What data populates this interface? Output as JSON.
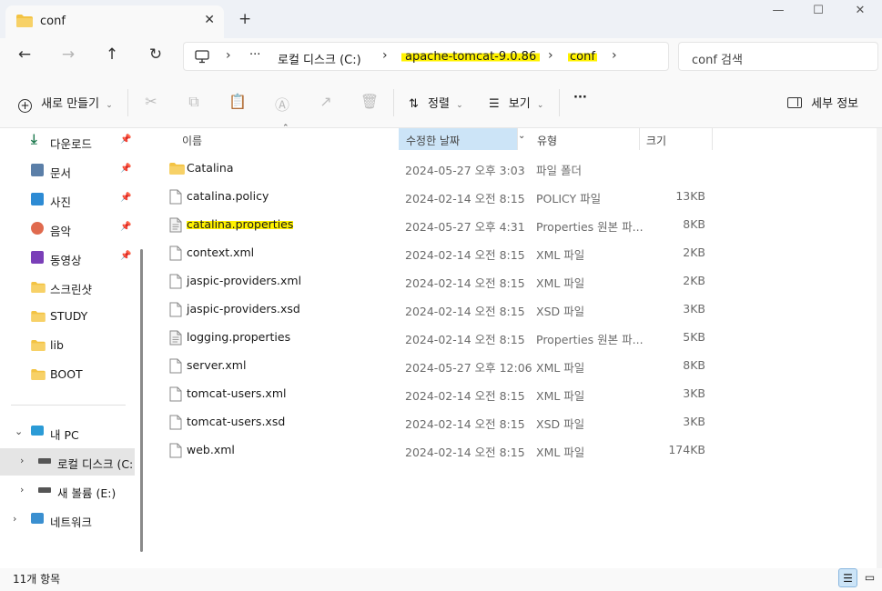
{
  "tab": {
    "title": "conf",
    "close": "✕",
    "new": "+"
  },
  "window": {
    "minimize": "—",
    "maximize": "☐",
    "close": "✕"
  },
  "nav": {
    "back": "←",
    "forward": "→",
    "up": "↑",
    "refresh": "↻"
  },
  "address": {
    "ellipsis": "···",
    "crumbs": [
      "로컬 디스크 (C:)",
      "apache-tomcat-9.0.86",
      "conf"
    ],
    "separator": "›"
  },
  "search": {
    "placeholder": "conf 검색"
  },
  "toolbar": {
    "new_label": "새로 만들기",
    "sort_label": "정렬",
    "view_label": "보기",
    "more_label": "···",
    "details_label": "세부 정보"
  },
  "sidebar": {
    "quick": [
      {
        "label": "다운로드",
        "icon": "download-icon",
        "pinned": true
      },
      {
        "label": "문서",
        "icon": "document-icon",
        "pinned": true
      },
      {
        "label": "사진",
        "icon": "picture-icon",
        "pinned": true
      },
      {
        "label": "음악",
        "icon": "music-icon",
        "pinned": true
      },
      {
        "label": "동영상",
        "icon": "video-icon",
        "pinned": true
      },
      {
        "label": "스크린샷",
        "icon": "folder-icon",
        "pinned": false
      },
      {
        "label": "STUDY",
        "icon": "folder-icon",
        "pinned": false
      },
      {
        "label": "lib",
        "icon": "folder-icon",
        "pinned": false
      },
      {
        "label": "BOOT",
        "icon": "folder-icon",
        "pinned": false
      }
    ],
    "tree": [
      {
        "label": "내 PC",
        "icon": "pc-icon"
      },
      {
        "label": "로컬 디스크 (C:",
        "icon": "drive-icon"
      },
      {
        "label": "새 볼륨 (E:)",
        "icon": "drive-icon"
      },
      {
        "label": "네트워크",
        "icon": "network-icon"
      }
    ]
  },
  "columns": {
    "name": "이름",
    "date": "수정한 날짜",
    "type": "유형",
    "size": "크기"
  },
  "files": [
    {
      "name": "Catalina",
      "date": "2024-05-27 오후 3:03",
      "type": "파일 폴더",
      "size": "",
      "kind": "folder"
    },
    {
      "name": "catalina.policy",
      "date": "2024-02-14 오전 8:15",
      "type": "POLICY 파일",
      "size": "13KB",
      "kind": "file"
    },
    {
      "name": "catalina.properties",
      "date": "2024-05-27 오후 4:31",
      "type": "Properties 원본 파...",
      "size": "8KB",
      "kind": "props",
      "highlight": true
    },
    {
      "name": "context.xml",
      "date": "2024-02-14 오전 8:15",
      "type": "XML 파일",
      "size": "2KB",
      "kind": "file"
    },
    {
      "name": "jaspic-providers.xml",
      "date": "2024-02-14 오전 8:15",
      "type": "XML 파일",
      "size": "2KB",
      "kind": "file"
    },
    {
      "name": "jaspic-providers.xsd",
      "date": "2024-02-14 오전 8:15",
      "type": "XSD 파일",
      "size": "3KB",
      "kind": "file"
    },
    {
      "name": "logging.properties",
      "date": "2024-02-14 오전 8:15",
      "type": "Properties 원본 파...",
      "size": "5KB",
      "kind": "props"
    },
    {
      "name": "server.xml",
      "date": "2024-05-27 오후 12:06",
      "type": "XML 파일",
      "size": "8KB",
      "kind": "file"
    },
    {
      "name": "tomcat-users.xml",
      "date": "2024-02-14 오전 8:15",
      "type": "XML 파일",
      "size": "3KB",
      "kind": "file"
    },
    {
      "name": "tomcat-users.xsd",
      "date": "2024-02-14 오전 8:15",
      "type": "XSD 파일",
      "size": "3KB",
      "kind": "file"
    },
    {
      "name": "web.xml",
      "date": "2024-02-14 오전 8:15",
      "type": "XML 파일",
      "size": "174KB",
      "kind": "file"
    }
  ],
  "status": {
    "count": "11개 항목"
  },
  "colors": {
    "highlight": "#fff200",
    "sorted_header": "#cce4f7",
    "folder": "#f3c343",
    "selected": "#e5e5e5"
  }
}
